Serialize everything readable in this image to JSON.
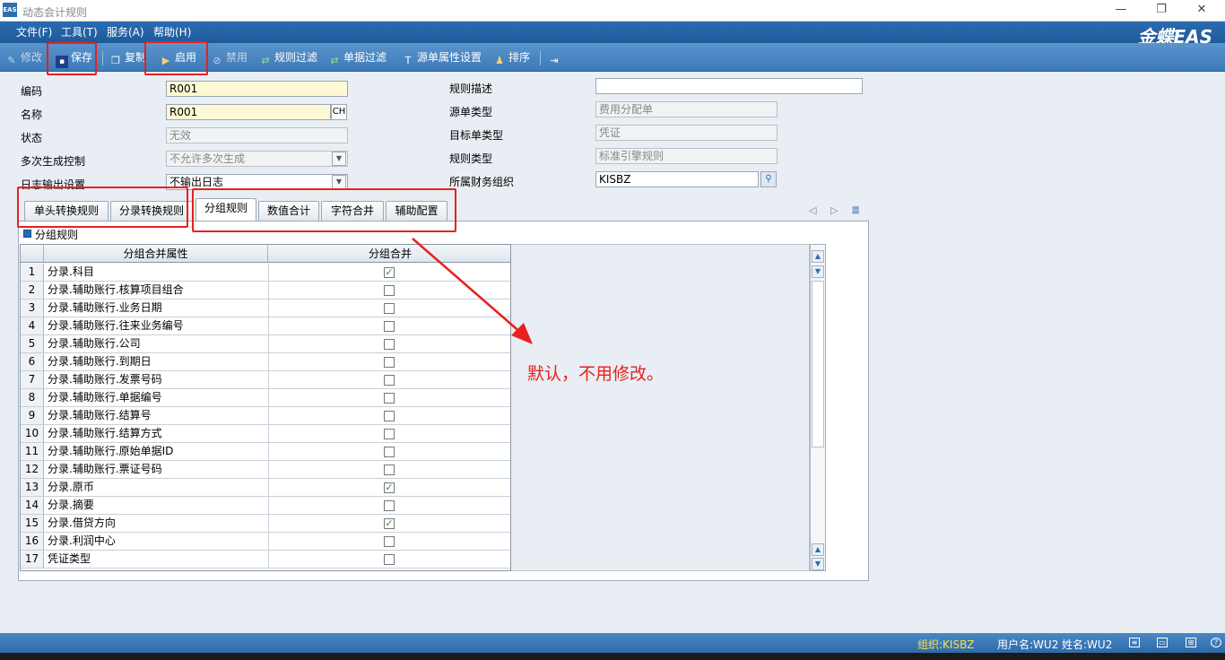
{
  "window": {
    "title": "动态会计规则",
    "app_icon_text": "EAS",
    "minimize": "—",
    "restore": "❐",
    "close": "✕"
  },
  "menu": {
    "items": [
      "文件(F)",
      "工具(T)",
      "服务(A)",
      "帮助(H)"
    ],
    "brand": "金蝶EAS"
  },
  "toolbar": {
    "edit": "修改",
    "save": "保存",
    "copy": "复制",
    "enable": "启用",
    "disable": "禁用",
    "rule_filter": "规则过滤",
    "doc_filter": "单据过滤",
    "source_attr": "源单属性设置",
    "sort": "排序"
  },
  "form": {
    "code_label": "编码",
    "code_value": "R001",
    "name_label": "名称",
    "name_value": "R001",
    "name_lang": "CH",
    "status_label": "状态",
    "status_value": "无效",
    "multi_label": "多次生成控制",
    "multi_value": "不允许多次生成",
    "log_label": "日志输出设置",
    "log_value": "不输出日志",
    "desc_label": "规则描述",
    "desc_value": "",
    "source_label": "源单类型",
    "source_value": "费用分配单",
    "target_label": "目标单类型",
    "target_value": "凭证",
    "type_label": "规则类型",
    "type_value": "标准引擎规则",
    "org_label": "所属财务组织",
    "org_value": "KISBZ"
  },
  "tabs": {
    "t1": "单头转换规则",
    "t2": "分录转换规则",
    "t3": "分组规则",
    "t4": "数值合计",
    "t5": "字符合并",
    "t6": "辅助配置"
  },
  "section": {
    "title": "分组规则"
  },
  "grid": {
    "col1": "分组合并属性",
    "col2": "分组合并",
    "rows": [
      {
        "n": "1",
        "name": "分录.科目",
        "checked": true
      },
      {
        "n": "2",
        "name": "分录.辅助账行.核算项目组合",
        "checked": false
      },
      {
        "n": "3",
        "name": "分录.辅助账行.业务日期",
        "checked": false
      },
      {
        "n": "4",
        "name": "分录.辅助账行.往来业务编号",
        "checked": false
      },
      {
        "n": "5",
        "name": "分录.辅助账行.公司",
        "checked": false
      },
      {
        "n": "6",
        "name": "分录.辅助账行.到期日",
        "checked": false
      },
      {
        "n": "7",
        "name": "分录.辅助账行.发票号码",
        "checked": false
      },
      {
        "n": "8",
        "name": "分录.辅助账行.单据编号",
        "checked": false
      },
      {
        "n": "9",
        "name": "分录.辅助账行.结算号",
        "checked": false
      },
      {
        "n": "10",
        "name": "分录.辅助账行.结算方式",
        "checked": false
      },
      {
        "n": "11",
        "name": "分录.辅助账行.原始单据ID",
        "checked": false
      },
      {
        "n": "12",
        "name": "分录.辅助账行.票证号码",
        "checked": false
      },
      {
        "n": "13",
        "name": "分录.原币",
        "checked": true
      },
      {
        "n": "14",
        "name": "分录.摘要",
        "checked": false
      },
      {
        "n": "15",
        "name": "分录.借贷方向",
        "checked": true
      },
      {
        "n": "16",
        "name": "分录.利润中心",
        "checked": false
      },
      {
        "n": "17",
        "name": "凭证类型",
        "checked": false
      }
    ]
  },
  "annotation": "默认，不用修改。",
  "status": {
    "org": "组织:KISBZ",
    "user": "用户名:WU2",
    "name": "姓名:WU2"
  },
  "colors": {
    "annotation": "#e8211c",
    "menubar": "#2b6bb0",
    "toolbar": "#4a88c4"
  }
}
